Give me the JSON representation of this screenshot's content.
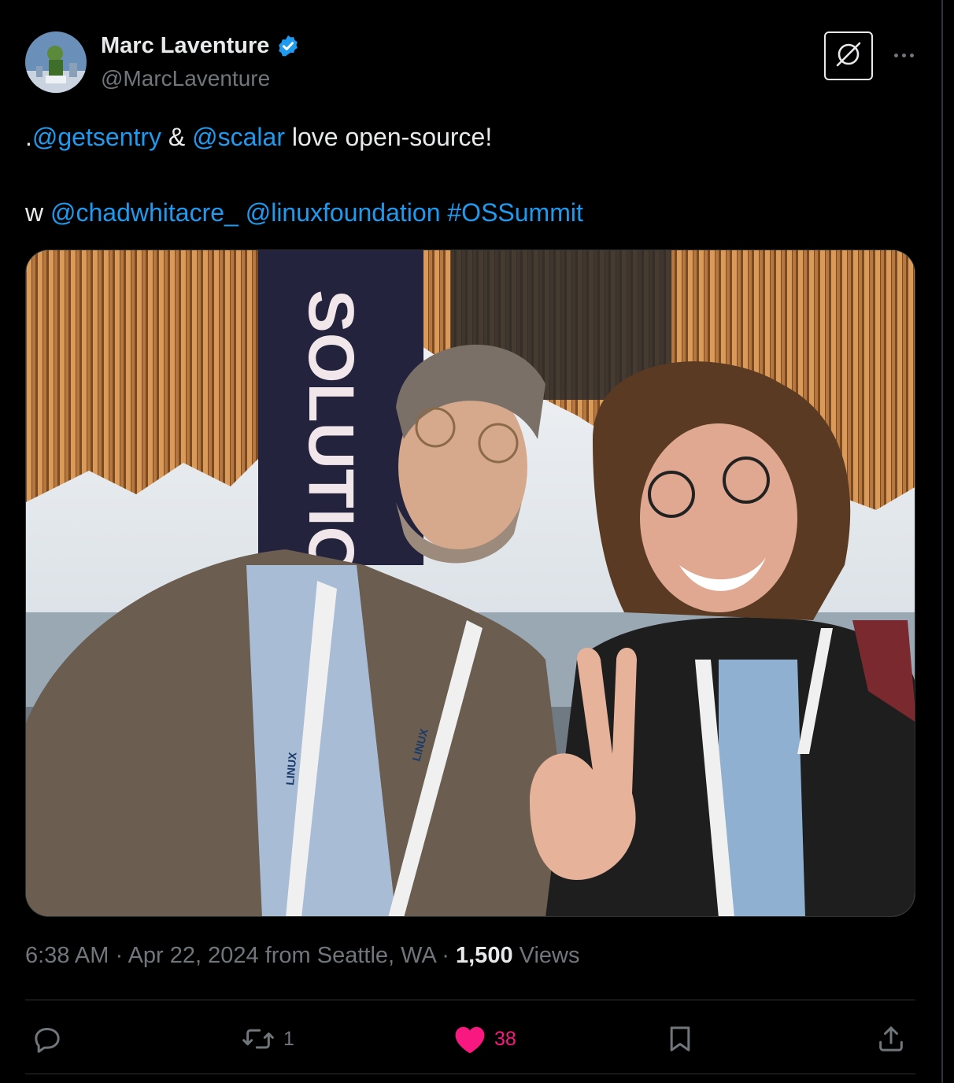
{
  "author": {
    "display_name": "Marc Laventure",
    "handle": "@MarcLaventure",
    "verified": true
  },
  "tweet": {
    "line1": {
      "prefix": ".",
      "mention1": "@getsentry",
      "connector": " & ",
      "mention2": "@scalar",
      "suffix": " love open-source!"
    },
    "line2": {
      "prefix": "w ",
      "mention1": "@chadwhitacre_",
      "mention2": "@linuxfoundation",
      "hashtag": "#OSSummit"
    }
  },
  "photo": {
    "banner_text": "SOLUTIONS",
    "lanyard_text": "LINUX"
  },
  "meta": {
    "time": "6:38 AM",
    "separator": " · ",
    "date": "Apr 22, 2024",
    "location": " from Seattle, WA",
    "views_count": "1,500",
    "views_label": " Views"
  },
  "actions": {
    "replies": "",
    "reposts": "1",
    "likes": "38",
    "liked": true
  },
  "icons": {
    "verified": "verified-badge-icon",
    "grok": "grok-icon",
    "more": "more-icon",
    "reply": "reply-icon",
    "repost": "repost-icon",
    "like": "heart-icon",
    "bookmark": "bookmark-icon",
    "share": "share-icon"
  },
  "colors": {
    "background": "#000000",
    "link": "#1d9bf0",
    "muted": "#71767b",
    "text": "#e7e9ea",
    "like": "#f91880",
    "verified": "#1d9bf0"
  }
}
